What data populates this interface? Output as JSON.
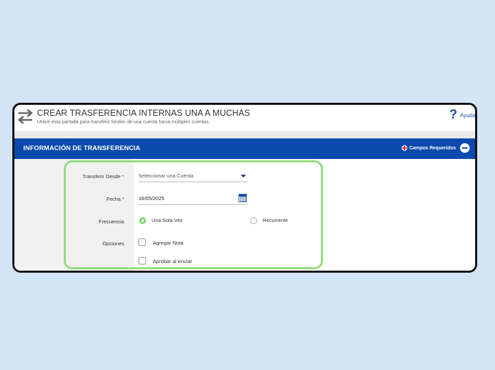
{
  "header": {
    "title": "CREAR TRASFERENCIA INTERNAS UNA A MUCHAS",
    "subtitle": "Utilice esta pantalla para transferir fondos de una cuenta hacia múltiples cuentas.",
    "help_label": "Ayuda"
  },
  "section": {
    "title": "INFORMACIÓN DE TRANSFERENCIA",
    "required_label": "Campos Requeridos"
  },
  "form": {
    "from": {
      "label": "Transferir Desde",
      "required_mark": "*",
      "value": "Seleccionar una Cuenta"
    },
    "date": {
      "label": "Fecha",
      "required_mark": "*",
      "value": "16/05/2025"
    },
    "frequency": {
      "label": "Frecuencia",
      "options": [
        "Una Sola Vez",
        "Recurrente"
      ],
      "selected": "Una Sola Vez"
    },
    "options": {
      "label": "Opciones",
      "checkboxes": [
        {
          "label": "Agregar Nota",
          "checked": false
        },
        {
          "label": "Aprobar al enviar",
          "checked": false
        }
      ]
    }
  },
  "colors": {
    "brand_blue": "#0a4aac",
    "highlight_green": "#93dc7d",
    "required_red": "#d62b2b"
  }
}
